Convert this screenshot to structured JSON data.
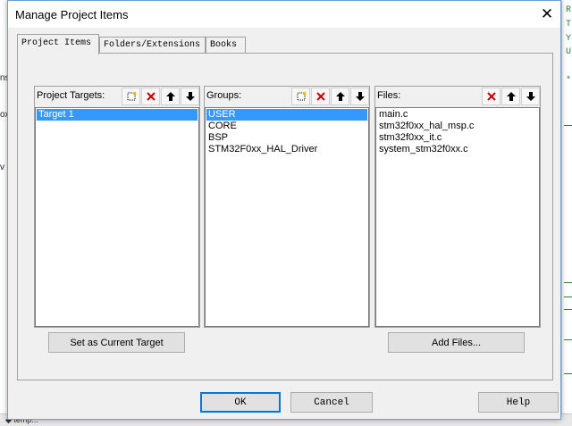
{
  "window": {
    "title": "Manage Project Items"
  },
  "tabs": [
    {
      "label": "Project Items",
      "active": true
    },
    {
      "label": "Folders/Extensions",
      "active": false
    },
    {
      "label": "Books",
      "active": false
    }
  ],
  "panels": {
    "targets": {
      "label": "Project Targets:",
      "items": [
        "Target 1"
      ],
      "selected": 0,
      "tools": [
        "new-icon",
        "delete-icon",
        "move-up-icon",
        "move-down-icon"
      ]
    },
    "groups": {
      "label": "Groups:",
      "items": [
        "USER",
        "CORE",
        "BSP",
        "STM32F0xx_HAL_Driver"
      ],
      "selected": 0,
      "tools": [
        "new-icon",
        "delete-icon",
        "move-up-icon",
        "move-down-icon"
      ]
    },
    "files": {
      "label": "Files:",
      "items": [
        "main.c",
        "stm32f0xx_hal_msp.c",
        "stm32f0xx_it.c",
        "system_stm32f0xx.c"
      ],
      "selected": null,
      "tools": [
        "delete-icon",
        "move-up-icon",
        "move-down-icon"
      ]
    }
  },
  "buttons": {
    "set_current_target": "Set as Current Target",
    "add_files": "Add Files...",
    "ok": "OK",
    "cancel": "Cancel",
    "help": "Help"
  },
  "background": {
    "left_fragments": [
      "ns",
      "ox",
      "v"
    ],
    "right_fragments": [
      "R",
      "T",
      "Y",
      "U",
      "*"
    ],
    "taskbar_fragment": "◆ temp..."
  },
  "colors": {
    "selection": "#3399ff",
    "accent_border": "#0078d7",
    "delete_red": "#cc0000"
  }
}
